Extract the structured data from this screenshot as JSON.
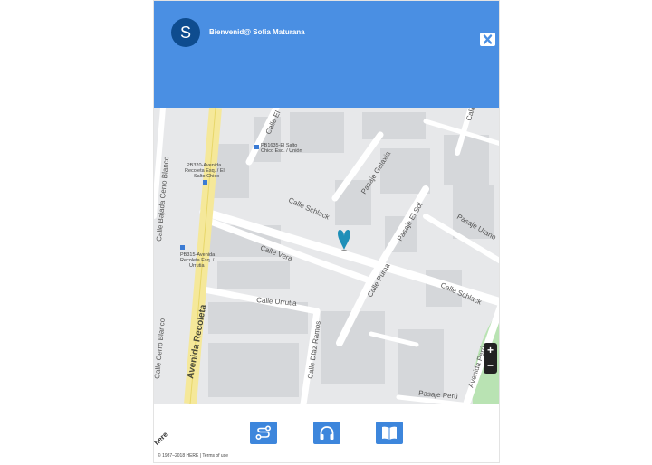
{
  "header": {
    "avatar_initial": "S",
    "welcome_text": "Bienvenid@ Sofia Maturana",
    "background_color": "#4a8fe3",
    "close_icon": "close-icon"
  },
  "map": {
    "streets": {
      "avenida_recoleta": "Avenida Recoleta",
      "avenida_peru": "Avenida Perú",
      "calle_schlack_1": "Calle Schlack",
      "calle_schlack_2": "Calle Schlack",
      "calle_vera": "Calle Vera",
      "calle_urrutia": "Calle Urrutia",
      "calle_diaz_ramos": "Calle Díaz Ramos",
      "calle_puma": "Calle Puma",
      "pasaje_el_sol": "Pasaje El Sol",
      "pasaje_galaxia": "Pasaje Galaxia",
      "pasaje_urano": "Pasaje Urano",
      "pasaje_peru": "Pasaje Perú",
      "calle_el": "Calle El",
      "calle_cerro_blanco_1": "Calle Bajada Cerro Blanco",
      "calle_cerro_blanco_2": "Calle Cerro Blanco",
      "calle_top_right": "Calle"
    },
    "bus_stops": {
      "stop_1_code": "PB1635-El Salto",
      "stop_1_sub": "Chico Esq. / Unión",
      "stop_2_code": "PB320-Avenida",
      "stop_2_sub1": "Recoleta Esq. / El",
      "stop_2_sub2": "Salto Chico",
      "stop_3_code": "PB315-Avenida",
      "stop_3_sub1": "Recoleta Esq. /",
      "stop_3_sub2": "Urrutia"
    },
    "zoom_in_label": "+",
    "zoom_out_label": "−",
    "marker_icon": "location-pin-icon"
  },
  "bottom_bar": {
    "actions": [
      {
        "name": "route",
        "icon": "route-icon"
      },
      {
        "name": "audio",
        "icon": "headphones-icon"
      },
      {
        "name": "guide",
        "icon": "book-icon"
      }
    ],
    "button_color": "#3d86dc",
    "here_logo": "here",
    "copyright": "© 1987–2018 HERE | Terms of use"
  }
}
